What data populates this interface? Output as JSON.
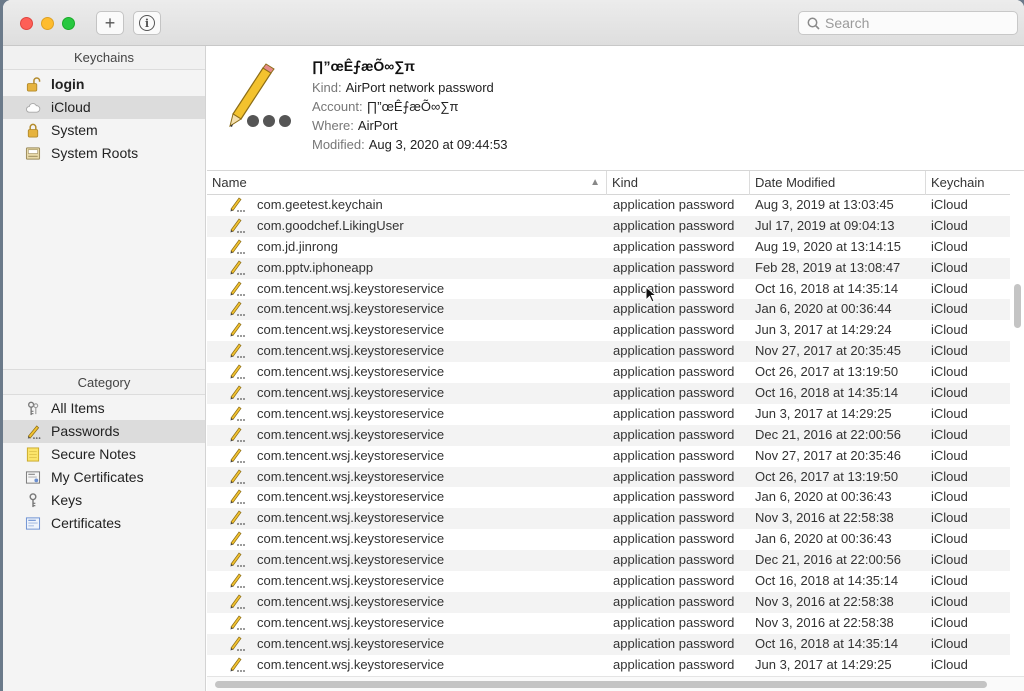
{
  "toolbar": {
    "add_label": "+",
    "info_label": "i",
    "search_placeholder": "Search"
  },
  "sidebar": {
    "keychains_header": "Keychains",
    "keychains": [
      {
        "label": "login",
        "icon": "unlocked-padlock-icon"
      },
      {
        "label": "iCloud",
        "icon": "cloud-icon"
      },
      {
        "label": "System",
        "icon": "padlock-icon"
      },
      {
        "label": "System Roots",
        "icon": "certificate-cabinet-icon"
      }
    ],
    "category_header": "Category",
    "categories": [
      {
        "label": "All Items",
        "icon": "keys-icon"
      },
      {
        "label": "Passwords",
        "icon": "pencil-icon"
      },
      {
        "label": "Secure Notes",
        "icon": "note-icon"
      },
      {
        "label": "My Certificates",
        "icon": "my-certificate-icon"
      },
      {
        "label": "Keys",
        "icon": "key-icon"
      },
      {
        "label": "Certificates",
        "icon": "certificate-icon"
      }
    ]
  },
  "detail": {
    "title": "∏”œÊ⨍æÕ∞∑π",
    "kind_label": "Kind:",
    "kind_value": "AirPort network password",
    "account_label": "Account:",
    "account_value": "∏”œÊ⨍æÕ∞∑π",
    "where_label": "Where:",
    "where_value": "AirPort",
    "modified_label": "Modified:",
    "modified_value": "Aug 3, 2020 at 09:44:53"
  },
  "table": {
    "columns": [
      "Name",
      "Kind",
      "Date Modified",
      "Keychain"
    ],
    "rows": [
      [
        "com.geetest.keychain",
        "application password",
        "Aug 3, 2019 at 13:03:45",
        "iCloud"
      ],
      [
        "com.goodchef.LikingUser",
        "application password",
        "Jul 17, 2019 at 09:04:13",
        "iCloud"
      ],
      [
        "com.jd.jinrong",
        "application password",
        "Aug 19, 2020 at 13:14:15",
        "iCloud"
      ],
      [
        "com.pptv.iphoneapp",
        "application password",
        "Feb 28, 2019 at 13:08:47",
        "iCloud"
      ],
      [
        "com.tencent.wsj.keystoreservice",
        "application password",
        "Oct 16, 2018 at 14:35:14",
        "iCloud"
      ],
      [
        "com.tencent.wsj.keystoreservice",
        "application password",
        "Jan 6, 2020 at 00:36:44",
        "iCloud"
      ],
      [
        "com.tencent.wsj.keystoreservice",
        "application password",
        "Jun 3, 2017 at 14:29:24",
        "iCloud"
      ],
      [
        "com.tencent.wsj.keystoreservice",
        "application password",
        "Nov 27, 2017 at 20:35:45",
        "iCloud"
      ],
      [
        "com.tencent.wsj.keystoreservice",
        "application password",
        "Oct 26, 2017 at 13:19:50",
        "iCloud"
      ],
      [
        "com.tencent.wsj.keystoreservice",
        "application password",
        "Oct 16, 2018 at 14:35:14",
        "iCloud"
      ],
      [
        "com.tencent.wsj.keystoreservice",
        "application password",
        "Jun 3, 2017 at 14:29:25",
        "iCloud"
      ],
      [
        "com.tencent.wsj.keystoreservice",
        "application password",
        "Dec 21, 2016 at 22:00:56",
        "iCloud"
      ],
      [
        "com.tencent.wsj.keystoreservice",
        "application password",
        "Nov 27, 2017 at 20:35:46",
        "iCloud"
      ],
      [
        "com.tencent.wsj.keystoreservice",
        "application password",
        "Oct 26, 2017 at 13:19:50",
        "iCloud"
      ],
      [
        "com.tencent.wsj.keystoreservice",
        "application password",
        "Jan 6, 2020 at 00:36:43",
        "iCloud"
      ],
      [
        "com.tencent.wsj.keystoreservice",
        "application password",
        "Nov 3, 2016 at 22:58:38",
        "iCloud"
      ],
      [
        "com.tencent.wsj.keystoreservice",
        "application password",
        "Jan 6, 2020 at 00:36:43",
        "iCloud"
      ],
      [
        "com.tencent.wsj.keystoreservice",
        "application password",
        "Dec 21, 2016 at 22:00:56",
        "iCloud"
      ],
      [
        "com.tencent.wsj.keystoreservice",
        "application password",
        "Oct 16, 2018 at 14:35:14",
        "iCloud"
      ],
      [
        "com.tencent.wsj.keystoreservice",
        "application password",
        "Nov 3, 2016 at 22:58:38",
        "iCloud"
      ],
      [
        "com.tencent.wsj.keystoreservice",
        "application password",
        "Nov 3, 2016 at 22:58:38",
        "iCloud"
      ],
      [
        "com.tencent.wsj.keystoreservice",
        "application password",
        "Oct 16, 2018 at 14:35:14",
        "iCloud"
      ],
      [
        "com.tencent.wsj.keystoreservice",
        "application password",
        "Jun 3, 2017 at 14:29:25",
        "iCloud"
      ]
    ]
  },
  "colors": {
    "close": "#fe5f57",
    "minimize": "#febc2e",
    "maximize": "#28c840",
    "selected_row": "#dcdcdc"
  }
}
